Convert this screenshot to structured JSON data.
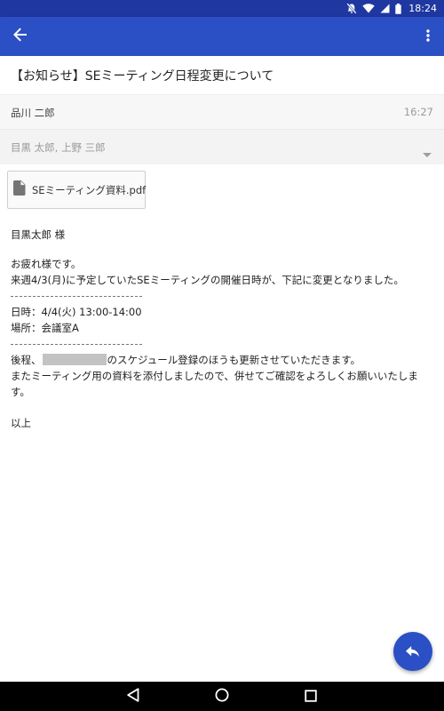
{
  "status_bar": {
    "time": "18:24",
    "icons": [
      "notifications-off-icon",
      "wifi-icon",
      "cellular-signal-icon",
      "battery-icon"
    ]
  },
  "app_bar": {
    "back_icon": "arrow-back-icon",
    "menu_icon": "more-vert-icon"
  },
  "message": {
    "subject": "【お知らせ】SEミーティング日程変更について",
    "sender": "品川 二郎",
    "time": "16:27",
    "recipients": "目黒 太郎, 上野 三郎",
    "attachment": {
      "name": "SEミーティング資料.pdf",
      "icon": "file-icon"
    },
    "body": {
      "greeting": "目黒太郎 様",
      "line1": "お疲れ様です。",
      "line2": "来週4/3(月)に予定していたSEミーティングの開催日時が、下記に変更となりました。",
      "datetime": "日時：4/4(火) 13:00-14:00",
      "location": "場所：会議室A",
      "line3_before": "後程、",
      "line3_after": "のスケジュール登録のほうも更新させていただきます。",
      "line4": "またミーティング用の資料を添付しましたので、併せてご確認をよろしくお願いいたします。",
      "closing": "以上"
    }
  },
  "fab": {
    "icon": "reply-icon"
  },
  "nav_bar": {
    "icons": [
      "nav-back-icon",
      "nav-home-icon",
      "nav-recents-icon"
    ]
  },
  "colors": {
    "primary": "#2b4fc4",
    "status_bar": "#1f37a0",
    "nav_bar": "#000000"
  }
}
